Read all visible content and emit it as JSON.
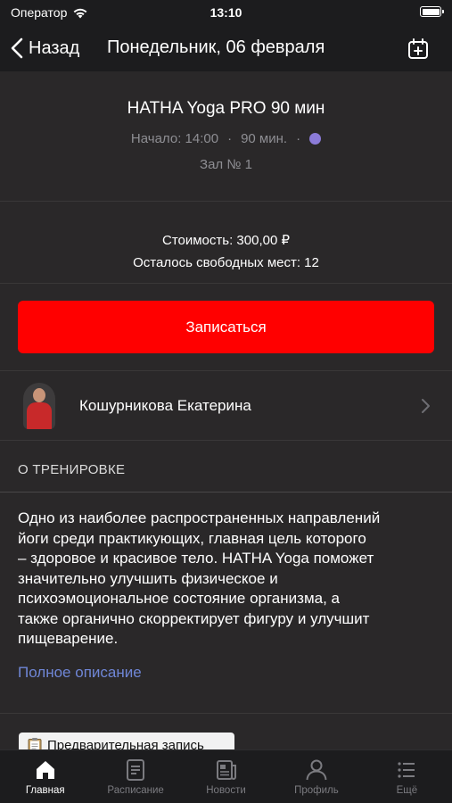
{
  "status_bar": {
    "carrier": "Оператор",
    "time": "13:10"
  },
  "nav": {
    "back_label": "Назад",
    "title": "Понедельник, 06 февраля"
  },
  "class_info": {
    "title": "HATHA Yoga PRO 90 мин",
    "start": "Начало: 14:00",
    "sep1": "·",
    "duration": "90 мин.",
    "sep2": "·",
    "room": "Зал № 1",
    "color": "#8b7bd8"
  },
  "pricing": {
    "cost": "Стоимость: 300,00 ₽",
    "seats_left": "Осталось свободных мест: 12"
  },
  "signup": {
    "label": "Записаться"
  },
  "trainer": {
    "name": "Кошурникова Екатерина"
  },
  "about": {
    "section_title": "О ТРЕНИРОВКЕ",
    "lines": [
      "Одно из наиболее распространенных направлений",
      "йоги среди практикующих, главная цель которого",
      "– здоровое и красивое тело. HATHA Yoga поможет",
      "значительно улучшить физическое и",
      "психоэмоциональное состояние организма, а",
      "также органично скорректирует фигуру и улучшит",
      "пищеварение."
    ],
    "more_link": "Полное описание"
  },
  "prebook": {
    "label": "Предварительная запись"
  },
  "tabs": [
    {
      "label": "Главная",
      "icon": "home-icon",
      "active": true
    },
    {
      "label": "Расписание",
      "icon": "schedule-icon",
      "active": false
    },
    {
      "label": "Новости",
      "icon": "news-icon",
      "active": false
    },
    {
      "label": "Профиль",
      "icon": "profile-icon",
      "active": false
    },
    {
      "label": "Ещё",
      "icon": "more-icon",
      "active": false
    }
  ]
}
